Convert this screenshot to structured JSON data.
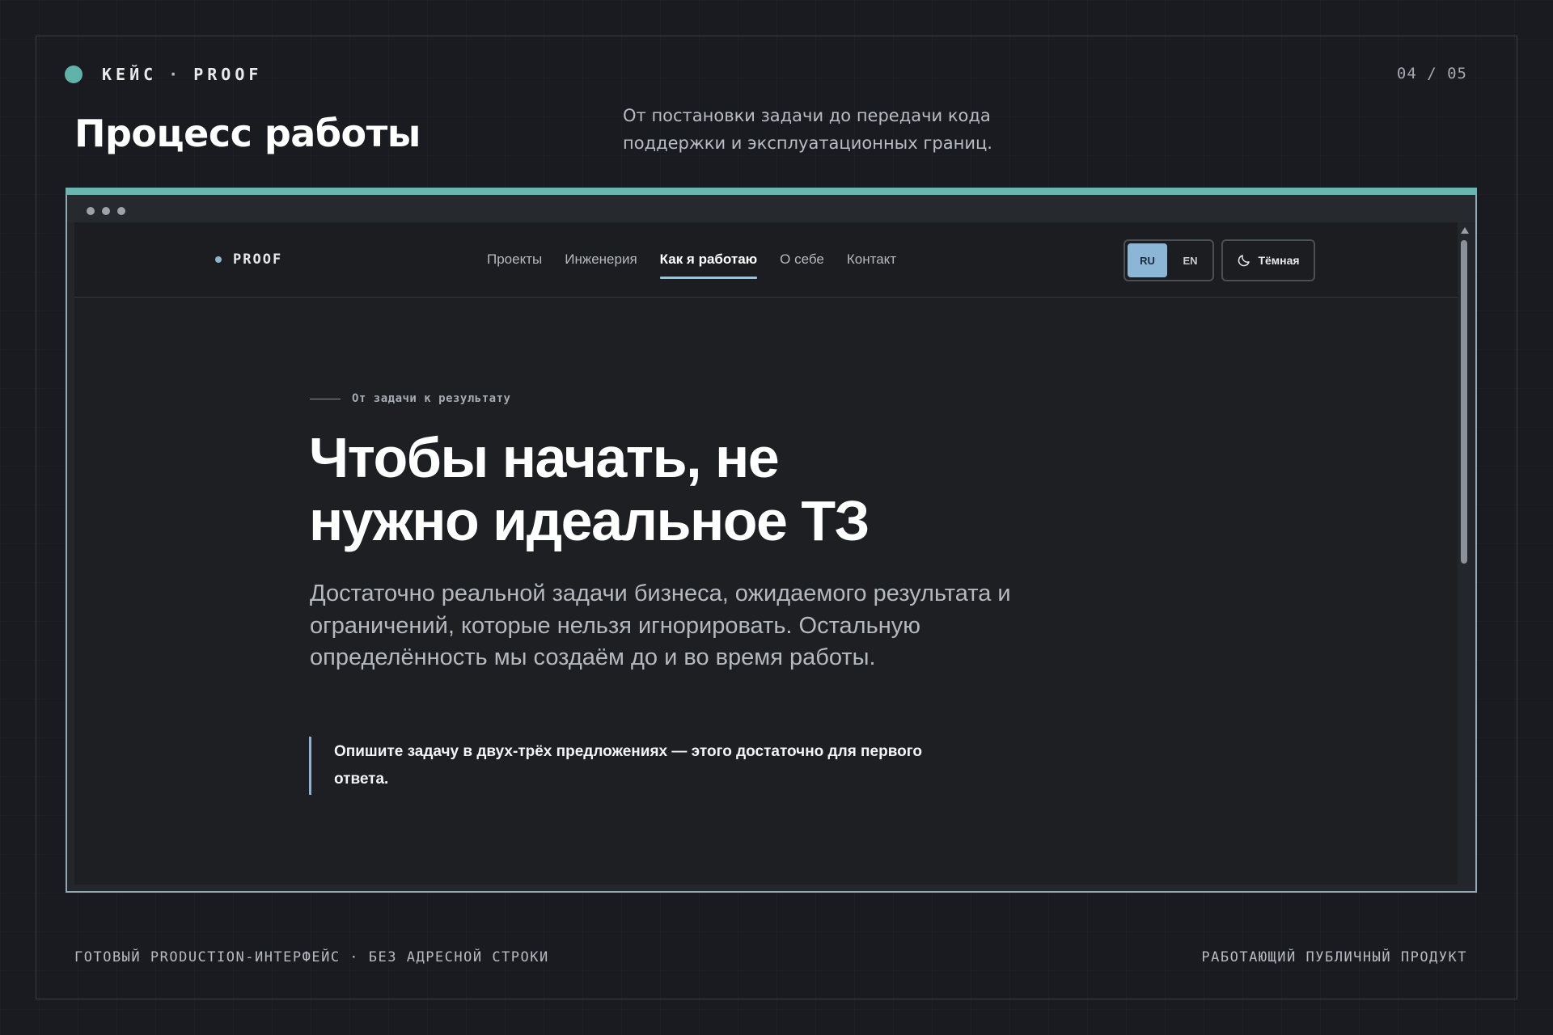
{
  "slide": {
    "kicker_case": "КЕЙС",
    "kicker_sep": "·",
    "kicker_brand": "PROOF",
    "page_counter": "04 / 05",
    "title": "Процесс работы",
    "subtitle": "От постановки задачи до передачи кода поддержки и эксплуатационных границ.",
    "accent_color": "#6ab5b0",
    "footer_left": "ГОТОВЫЙ PRODUCTION-ИНТЕРФЕЙС · БЕЗ АДРЕСНОЙ СТРОКИ",
    "footer_right": "РАБОТАЮЩИЙ ПУБЛИЧНЫЙ ПРОДУКТ"
  },
  "site": {
    "brand": "PROOF",
    "nav": [
      {
        "label": "Проекты",
        "active": false
      },
      {
        "label": "Инженерия",
        "active": false
      },
      {
        "label": "Как я работаю",
        "active": true
      },
      {
        "label": "О себе",
        "active": false
      },
      {
        "label": "Контакт",
        "active": false
      }
    ],
    "lang_options": [
      {
        "label": "RU",
        "selected": true
      },
      {
        "label": "EN",
        "selected": false
      }
    ],
    "theme_label": "Тёмная",
    "theme_icon": "moon-icon",
    "eyebrow": "От задачи к результату",
    "hero_line1": "Чтобы начать, не",
    "hero_line2": "нужно идеальное ТЗ",
    "lead": "Достаточно реальной задачи бизнеса, ожидаемого результата и ограничений, которые нельзя игнорировать. Остальную определённость мы создаём до и во время работы.",
    "callout": "Опишите задачу в двух-трёх предложениях — этого достаточно для первого ответа."
  }
}
